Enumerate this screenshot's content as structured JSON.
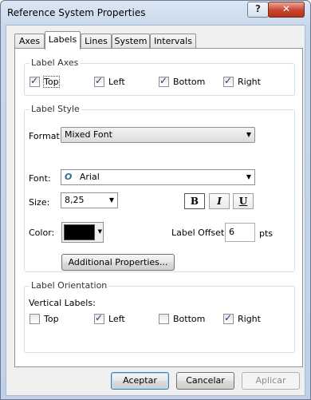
{
  "window": {
    "title": "Reference System Properties"
  },
  "titlebar": {
    "help_label": "?",
    "close_label": "✕"
  },
  "tabs": [
    {
      "label": "Axes"
    },
    {
      "label": "Labels"
    },
    {
      "label": "Lines"
    },
    {
      "label": "System"
    },
    {
      "label": "Intervals"
    }
  ],
  "label_axes": {
    "title": "Label Axes",
    "options": [
      {
        "label": "Top",
        "checked": true
      },
      {
        "label": "Left",
        "checked": true
      },
      {
        "label": "Bottom",
        "checked": true
      },
      {
        "label": "Right",
        "checked": true
      }
    ]
  },
  "label_style": {
    "title": "Label Style",
    "format_label": "Format:",
    "format_value": "Mixed Font",
    "font_label": "Font:",
    "font_icon_glyph": "O",
    "font_value": "Arial",
    "size_label": "Size:",
    "size_value": "8,25",
    "bold_label": "B",
    "italic_label": "I",
    "underline_label": "U",
    "bold_pressed": true,
    "color_label": "Color:",
    "color_value": "#000000",
    "offset_label": "Label Offset:",
    "offset_value": "6",
    "offset_unit": "pts",
    "additional_button": "Additional Properties..."
  },
  "label_orientation": {
    "title": "Label Orientation",
    "vertical_labels": "Vertical Labels:",
    "options": [
      {
        "label": "Top",
        "checked": false
      },
      {
        "label": "Left",
        "checked": true
      },
      {
        "label": "Bottom",
        "checked": false
      },
      {
        "label": "Right",
        "checked": true
      }
    ]
  },
  "footer": {
    "ok_label": "Aceptar",
    "cancel_label": "Cancelar",
    "apply_label": "Aplicar"
  },
  "icons": {
    "dropdown": "chevron-down-icon",
    "check": "check-icon",
    "font_type": "opentype-font-icon"
  }
}
